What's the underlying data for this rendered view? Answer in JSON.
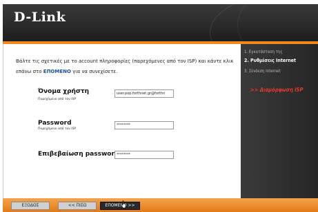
{
  "brand": {
    "logo_text": "D-Link"
  },
  "steps": [
    {
      "label": "1. Εγκατάσταση της",
      "state": "done"
    },
    {
      "label": "2. Ρυθμίσεις Internet",
      "state": "active"
    },
    {
      "label": "3. Σύνδεση Internet",
      "state": "pending"
    }
  ],
  "substep": ">> Διαμόρφωση ISP",
  "intro": {
    "part1": "Βάλτε τις σχετικές με το account πληροφορίες (παρεχόμενες από τον ISP) και κάντε κλικ επάνω στο ",
    "highlight": "ΕΠΟΜΕΝΟ",
    "part2": " για να συνεχίσετε."
  },
  "fields": {
    "username": {
      "label": "Όνομα χρήστη",
      "sub": "Παρεχόμενο από τον ISP",
      "value": "user.pop.forthnet.gr@forthn"
    },
    "password": {
      "label": "Password",
      "sub": "Παρεχόμενο από τον ISP",
      "value": "********"
    },
    "confirm": {
      "label": "Επιβεβαίωση password",
      "value": "********"
    }
  },
  "buttons": {
    "exit": "ΕΞΟΔΟΣ",
    "back": "<< ΠΙΣΩ",
    "next": "ΕΠΟΜΕΝΟ >>"
  },
  "colors": {
    "accent_orange": "#f08a1c",
    "substep_red": "#e53a2a",
    "link_blue": "#1a4fa0"
  }
}
